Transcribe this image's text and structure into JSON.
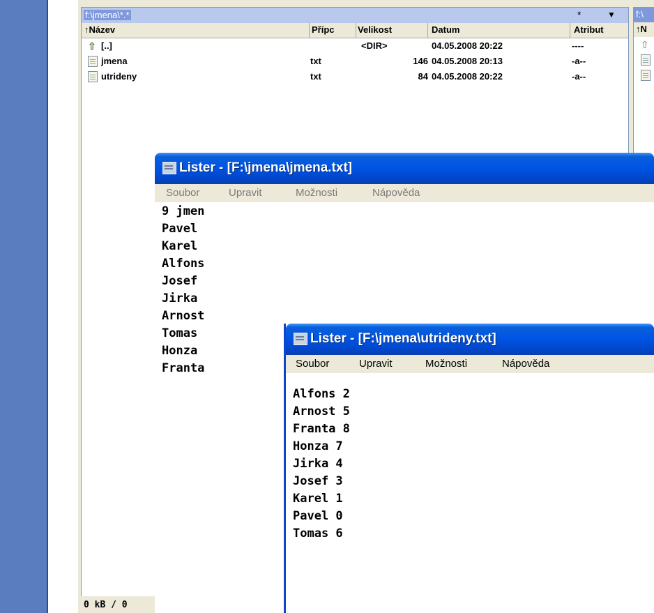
{
  "panel": {
    "path": "f:\\jmena\\*.*",
    "star": "*",
    "dropdown_arrow": "▼",
    "columns": [
      "↑Název",
      "Přípc",
      "Velikost",
      "Datum",
      "Atribut"
    ],
    "rows": [
      {
        "name": "[..]",
        "ext": "",
        "size": "<DIR>",
        "date": "04.05.2008 20:22",
        "attr": "----",
        "icon": "up-folder-icon"
      },
      {
        "name": "jmena",
        "ext": "txt",
        "size": "146",
        "date": "04.05.2008 20:13",
        "attr": "-a--",
        "icon": "text-file-icon"
      },
      {
        "name": "utrideny",
        "ext": "txt",
        "size": "84",
        "date": "04.05.2008 20:22",
        "attr": "-a--",
        "icon": "text-file-icon"
      }
    ],
    "status": "0 kB / 0",
    "right_path": "f:\\",
    "right_col": "↑N"
  },
  "lister1": {
    "title": "Lister - [F:\\jmena\\jmena.txt]",
    "menu": [
      "Soubor",
      "Upravit",
      "Možnosti",
      "Nápověda"
    ],
    "lines": [
      "9 jmen",
      "Pavel",
      "Karel",
      "Alfons",
      "Josef",
      "Jirka",
      "Arnost",
      "Tomas",
      "Honza",
      "Franta"
    ]
  },
  "lister2": {
    "title": "Lister - [F:\\jmena\\utrideny.txt]",
    "menu": [
      "Soubor",
      "Upravit",
      "Možnosti",
      "Nápověda"
    ],
    "lines": [
      "Alfons 2",
      "Arnost 5",
      "Franta 8",
      "Honza 7",
      "Jirka 4",
      "Josef 3",
      "Karel 1",
      "Pavel 0",
      "Tomas 6"
    ]
  },
  "colors": {
    "desktop": "#5a7dc0",
    "titlebar": "#0055e5",
    "path_highlight": "#7e98dc"
  }
}
